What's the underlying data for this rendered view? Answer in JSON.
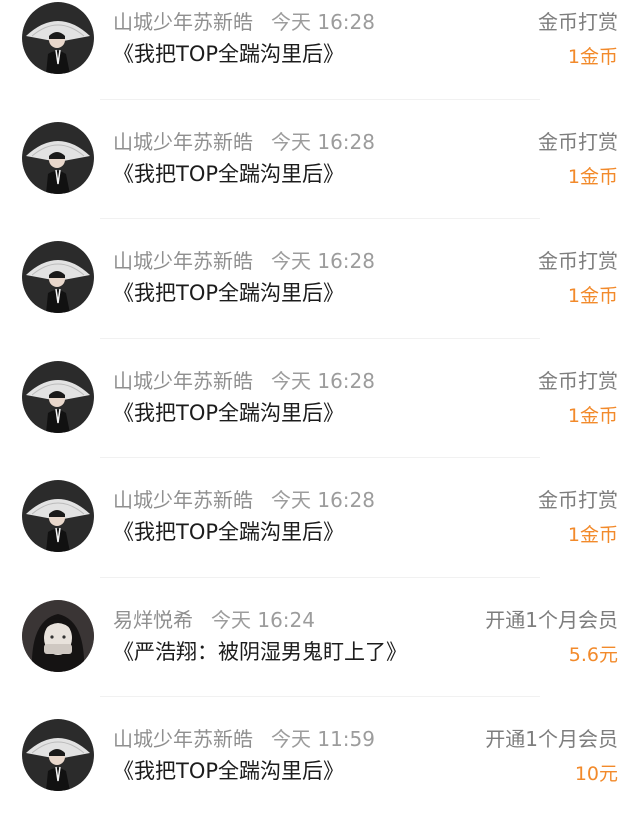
{
  "records": [
    {
      "user": "山城少年苏新皓",
      "time": "今天 16:28",
      "title": "《我把TOP全踹沟里后》",
      "action": "金币打赏",
      "amount": "1金币",
      "avatar": "avatar-umbrella"
    },
    {
      "user": "山城少年苏新皓",
      "time": "今天 16:28",
      "title": "《我把TOP全踹沟里后》",
      "action": "金币打赏",
      "amount": "1金币",
      "avatar": "avatar-umbrella"
    },
    {
      "user": "山城少年苏新皓",
      "time": "今天 16:28",
      "title": "《我把TOP全踹沟里后》",
      "action": "金币打赏",
      "amount": "1金币",
      "avatar": "avatar-umbrella"
    },
    {
      "user": "山城少年苏新皓",
      "time": "今天 16:28",
      "title": "《我把TOP全踹沟里后》",
      "action": "金币打赏",
      "amount": "1金币",
      "avatar": "avatar-umbrella"
    },
    {
      "user": "山城少年苏新皓",
      "time": "今天 16:28",
      "title": "《我把TOP全踹沟里后》",
      "action": "金币打赏",
      "amount": "1金币",
      "avatar": "avatar-umbrella"
    },
    {
      "user": "易烊悦希",
      "time": "今天 16:24",
      "title": "《严浩翔：被阴湿男鬼盯上了》",
      "action": "开通1个月会员",
      "amount": "5.6元",
      "avatar": "avatar-girl"
    },
    {
      "user": "山城少年苏新皓",
      "time": "今天 11:59",
      "title": "《我把TOP全踹沟里后》",
      "action": "开通1个月会员",
      "amount": "10元",
      "avatar": "avatar-umbrella"
    }
  ],
  "colors": {
    "amount": "#f28a2b",
    "muted": "#8f8f8f",
    "title": "#1c1c1c"
  }
}
